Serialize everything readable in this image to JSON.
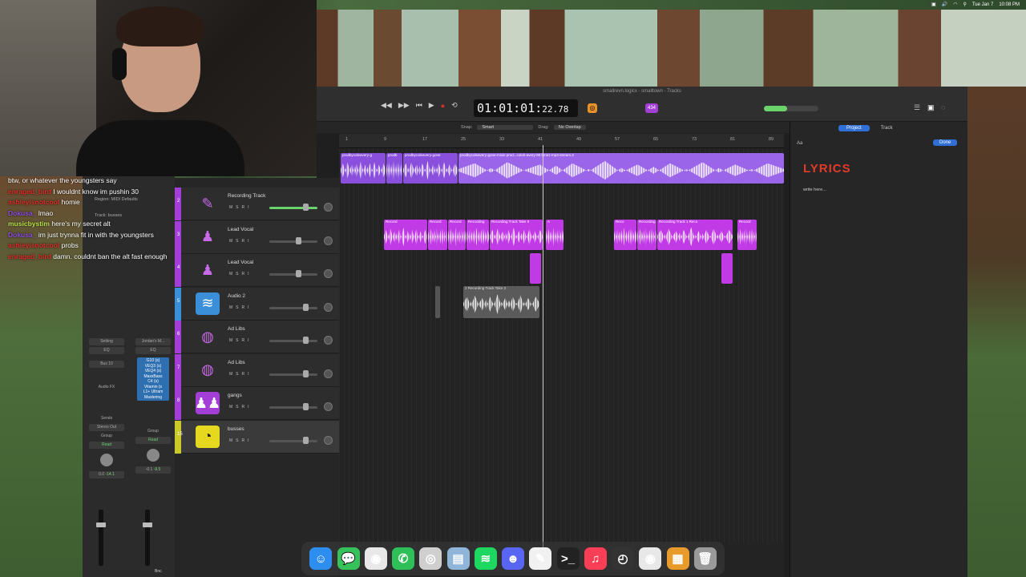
{
  "menubar": {
    "date": "Tue Jan 7",
    "time": "10:08 PM"
  },
  "chat": {
    "messages": [
      {
        "user": "",
        "text": "btw, or whatever the youngsters say",
        "color": "#ffffff"
      },
      {
        "user": "enraged_bird",
        "text": "I wouldnt know im pushin 30",
        "color": "#e0302a"
      },
      {
        "user": "ashleyisnotcool",
        "text": "homie",
        "color": "#e0302a"
      },
      {
        "user": "Dokusa_",
        "text": "lmao",
        "color": "#8e4fe0"
      },
      {
        "user": "musicbystim",
        "text": "here's my secret alt",
        "color": "#b7e24a"
      },
      {
        "user": "Dokusa_",
        "text": "im just trynna fit in with the youngsters",
        "color": "#8e4fe0"
      },
      {
        "user": "ashleyisnotcool",
        "text": "probs",
        "color": "#e0302a"
      },
      {
        "user": "enraged_bird",
        "text": "damn. couldnt ban the alt fast enough",
        "color": "#e0302a"
      }
    ]
  },
  "inspector": {
    "region_label": "Region: MIDI Defaults",
    "track_label": "Track: busses",
    "strip1": {
      "setting": "Setting",
      "eq": "EQ",
      "bus": "Bus 10",
      "audio_fx": "Audio FX",
      "sends": "Sends",
      "output": "Stereo Out",
      "group": "Group",
      "read": "Read",
      "pan_val": "0.0",
      "vol_val": "-14.1"
    },
    "strip2": {
      "setting": "Jordan's M...",
      "eq": "EQ",
      "plugins": [
        "G10 (s)",
        "VEQ3 (s)",
        "VEQ4 (s)",
        "MaxxBass",
        "C4 (s)",
        "Vitamin (s",
        "L1+ Ultram",
        "Mastering"
      ],
      "group": "Group",
      "read": "Read",
      "pan_val": "-0.1",
      "vol_val": "-9.5",
      "name": "Bnc"
    }
  },
  "window": {
    "title": "smallrevn.logicx - smalltown - Tracks"
  },
  "transport": {
    "lcd_main": "01:01:01:",
    "lcd_sub": "22.78",
    "key": "434"
  },
  "toolbar": {
    "snap_label": "Snap:",
    "snap_value": "Smart",
    "drag_label": "Drag:",
    "drag_value": "No Overlap"
  },
  "ruler": [
    "1",
    "9",
    "17",
    "25",
    "33",
    "41",
    "49",
    "57",
    "65",
    "73",
    "81",
    "89"
  ],
  "tracks": [
    {
      "num": "2",
      "name": "Recording Track",
      "color": "#a33fd6",
      "icon": "✎",
      "icon_bg": "transparent",
      "icon_color": "#c86ae8",
      "vol": 0.7
    },
    {
      "num": "3",
      "name": "Lead Vocal",
      "color": "#a33fd6",
      "icon": "♟",
      "icon_bg": "transparent",
      "icon_color": "#c86ae8",
      "vol": 0.55
    },
    {
      "num": "4",
      "name": "Lead Vocal",
      "color": "#a33fd6",
      "icon": "♟",
      "icon_bg": "transparent",
      "icon_color": "#c86ae8",
      "vol": 0.55
    },
    {
      "num": "5",
      "name": "Audio 2",
      "color": "#3b8fd8",
      "icon": "≋",
      "icon_bg": "#3b8fd8",
      "icon_color": "#ffffff",
      "vol": 0.7
    },
    {
      "num": "6",
      "name": "Ad Libs",
      "color": "#a33fd6",
      "icon": "◍",
      "icon_bg": "transparent",
      "icon_color": "#c86ae8",
      "vol": 0.7
    },
    {
      "num": "7",
      "name": "Ad Libs",
      "color": "#a33fd6",
      "icon": "◍",
      "icon_bg": "transparent",
      "icon_color": "#c86ae8",
      "vol": 0.7
    },
    {
      "num": "8",
      "name": "gangs",
      "color": "#a33fd6",
      "icon": "♟♟",
      "icon_bg": "#a33fd6",
      "icon_color": "#ffffff",
      "vol": 0.7
    },
    {
      "num": "15",
      "name": "busses",
      "color": "#c9c92a",
      "icon": "◔",
      "icon_bg": "#e6d81e",
      "icon_color": "#222222",
      "vol": 0.7
    }
  ],
  "regions": {
    "beat": [
      "prodbycoleavery-g",
      "prodb",
      "prodbycoleavery-gone",
      "prodbycoleavery-gone-mixin prod...coleb-avery-80 bmez-mp3-stream.3"
    ],
    "vocal_labels": [
      "Record",
      "Record",
      "Record",
      "Recording",
      "Recording Track Take 5",
      "A",
      "Reco",
      "Recording",
      "Recording Track 1 Reco",
      "Record"
    ],
    "audio2_label": "2 Recording Track Take 3"
  },
  "right_panel": {
    "tab_project": "Project",
    "tab_track": "Track",
    "done": "Done",
    "aa": "Aa",
    "lyrics_title": "LYRICS",
    "placeholder": "write here..."
  },
  "dock": [
    {
      "name": "finder-icon",
      "glyph": "☺",
      "bg": "#2d8ef0"
    },
    {
      "name": "messages-icon",
      "glyph": "💬",
      "bg": "#36c25a"
    },
    {
      "name": "chrome-icon",
      "glyph": "◉",
      "bg": "#e8e8e8"
    },
    {
      "name": "whatsapp-icon",
      "glyph": "✆",
      "bg": "#2fbf59"
    },
    {
      "name": "logic-icon",
      "glyph": "◎",
      "bg": "#cfcfcf"
    },
    {
      "name": "preview-icon",
      "glyph": "▤",
      "bg": "#8fb5d8"
    },
    {
      "name": "spotify-icon",
      "glyph": "≋",
      "bg": "#1ed760"
    },
    {
      "name": "discord-icon",
      "glyph": "☻",
      "bg": "#5865f2"
    },
    {
      "name": "textedit-icon",
      "glyph": "✎",
      "bg": "#f1f1f1"
    },
    {
      "name": "terminal-icon",
      "glyph": ">_",
      "bg": "#222222"
    },
    {
      "name": "music-icon",
      "glyph": "♫",
      "bg": "#fa3e55"
    },
    {
      "name": "activity-icon",
      "glyph": "◴",
      "bg": "#333333"
    },
    {
      "name": "chrome-alt-icon",
      "glyph": "◉",
      "bg": "#e8e8e8"
    },
    {
      "name": "archive-icon",
      "glyph": "▦",
      "bg": "#e89a2a"
    },
    {
      "name": "trash-icon",
      "glyph": "🗑",
      "bg": "#9a9a9a"
    }
  ]
}
